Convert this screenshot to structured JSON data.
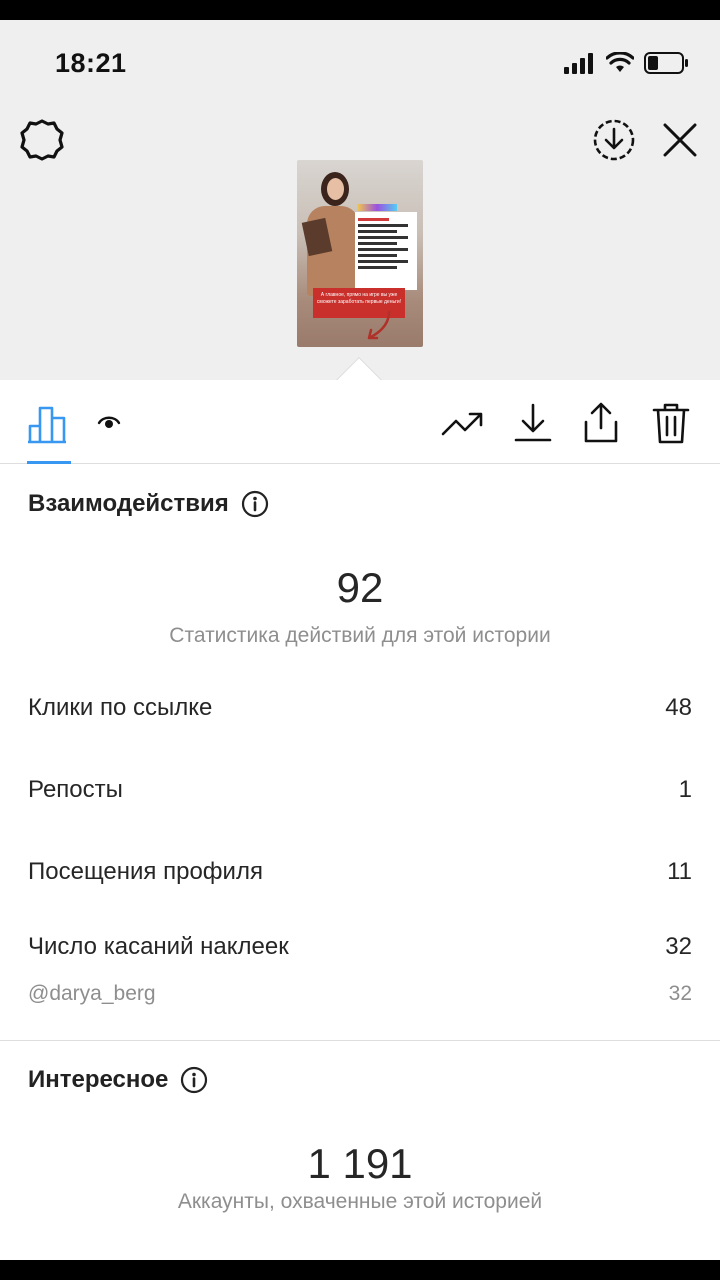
{
  "status_bar": {
    "time": "18:21"
  },
  "header": {
    "settings_icon": "settings-gear-icon",
    "download_icon": "download-circle-icon",
    "close_icon": "close-icon"
  },
  "story_thumbnail": {
    "banner_text": "А главное, прямо на игре вы уже сможете заработать первые деньги!"
  },
  "toolbar": {
    "tabs": [
      "insights-bar-chart-icon",
      "viewers-eye-icon"
    ],
    "actions": [
      "promote-trend-icon",
      "save-download-icon",
      "share-icon",
      "delete-trash-icon"
    ]
  },
  "interactions": {
    "title": "Взаимодействия",
    "total": "92",
    "caption": "Статистика действий для этой истории",
    "rows": [
      {
        "label": "Клики по ссылке",
        "value": "48"
      },
      {
        "label": "Репосты",
        "value": "1"
      },
      {
        "label": "Посещения профиля",
        "value": "11"
      },
      {
        "label": "Число касаний наклеек",
        "value": "32"
      }
    ],
    "sub_row": {
      "label": "@darya_berg",
      "value": "32"
    }
  },
  "discovery": {
    "title": "Интересное",
    "total": "1 191",
    "caption": "Аккаунты, охваченные этой историей"
  },
  "colors": {
    "accent": "#3897f0",
    "text": "#262626",
    "muted": "#8e8e8e",
    "header_bg": "#efefef"
  }
}
